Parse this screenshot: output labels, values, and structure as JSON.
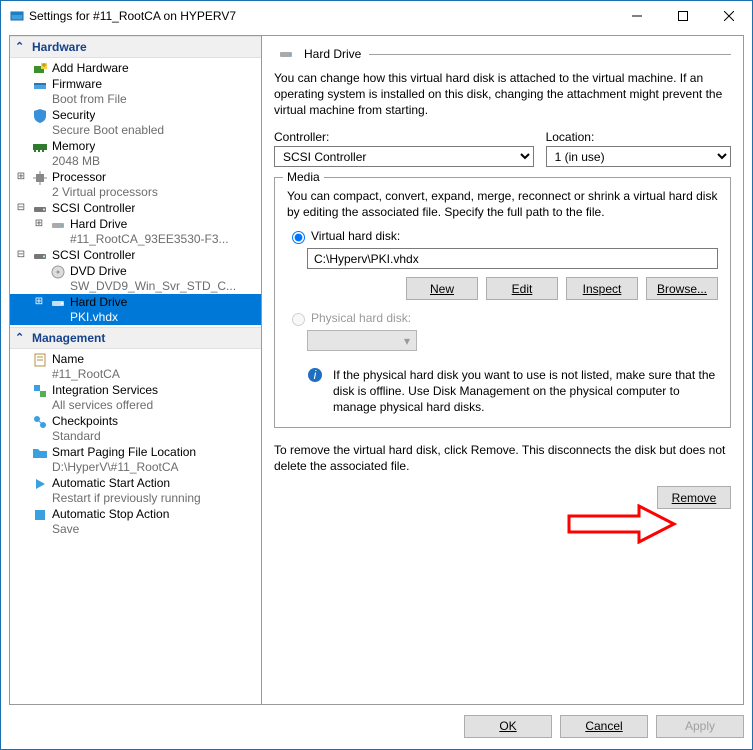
{
  "window": {
    "title": "Settings for #11_RootCA on HYPERV7"
  },
  "tree": {
    "hardware_header": "Hardware",
    "management_header": "Management",
    "items": {
      "add_hw": "Add Hardware",
      "firmware": "Firmware",
      "firmware_sub": "Boot from File",
      "security": "Security",
      "security_sub": "Secure Boot enabled",
      "memory": "Memory",
      "memory_sub": "2048 MB",
      "processor": "Processor",
      "processor_sub": "2 Virtual processors",
      "scsi1": "SCSI Controller",
      "hdd1": "Hard Drive",
      "hdd1_sub": "#11_RootCA_93EE3530-F3...",
      "scsi2": "SCSI Controller",
      "dvd": "DVD Drive",
      "dvd_sub": "SW_DVD9_Win_Svr_STD_C...",
      "hdd2": "Hard Drive",
      "hdd2_sub": "PKI.vhdx",
      "name": "Name",
      "name_sub": "#11_RootCA",
      "integ": "Integration Services",
      "integ_sub": "All services offered",
      "chk": "Checkpoints",
      "chk_sub": "Standard",
      "spf": "Smart Paging File Location",
      "spf_sub": "D:\\HyperV\\#11_RootCA",
      "asa": "Automatic Start Action",
      "asa_sub": "Restart if previously running",
      "asto": "Automatic Stop Action",
      "asto_sub": "Save"
    }
  },
  "panel": {
    "title": "Hard Drive",
    "desc": "You can change how this virtual hard disk is attached to the virtual machine. If an operating system is installed on this disk, changing the attachment might prevent the virtual machine from starting.",
    "controller_label": "Controller:",
    "controller_value": "SCSI Controller",
    "location_label": "Location:",
    "location_value": "1 (in use)",
    "media_label": "Media",
    "media_desc": "You can compact, convert, expand, merge, reconnect or shrink a virtual hard disk by editing the associated file. Specify the full path to the file.",
    "vhd_radio": "Virtual hard disk:",
    "vhd_path": "C:\\Hyperv\\PKI.vhdx",
    "btn_new": "New",
    "btn_edit": "Edit",
    "btn_inspect": "Inspect",
    "btn_browse": "Browse...",
    "phd_radio": "Physical hard disk:",
    "info_text": "If the physical hard disk you want to use is not listed, make sure that the disk is offline. Use Disk Management on the physical computer to manage physical hard disks.",
    "remove_desc": "To remove the virtual hard disk, click Remove. This disconnects the disk but does not delete the associated file.",
    "btn_remove": "Remove"
  },
  "footer": {
    "ok": "OK",
    "cancel": "Cancel",
    "apply": "Apply"
  }
}
